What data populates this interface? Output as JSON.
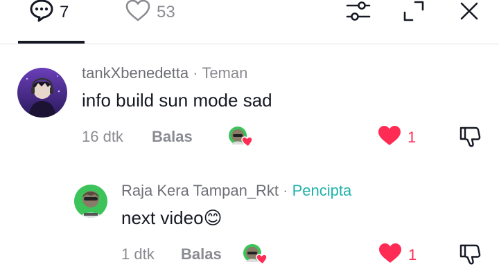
{
  "tabs": {
    "comments_count": "7",
    "likes_count": "53"
  },
  "comments": [
    {
      "username": "tankXbenedetta",
      "separator": "·",
      "tag": "Teman",
      "text": "info build sun mode sad",
      "time": "16 dtk",
      "reply_label": "Balas",
      "like_count": "1"
    },
    {
      "username": "Raja Kera Tampan_Rkt",
      "separator": "·",
      "tag": "Pencipta",
      "text": "next video😊",
      "time": "1 dtk",
      "reply_label": "Balas",
      "like_count": "1"
    }
  ],
  "colors": {
    "like_red": "#fe2c55",
    "creator_teal": "#20b2aa",
    "muted_gray": "#8a8b91"
  }
}
